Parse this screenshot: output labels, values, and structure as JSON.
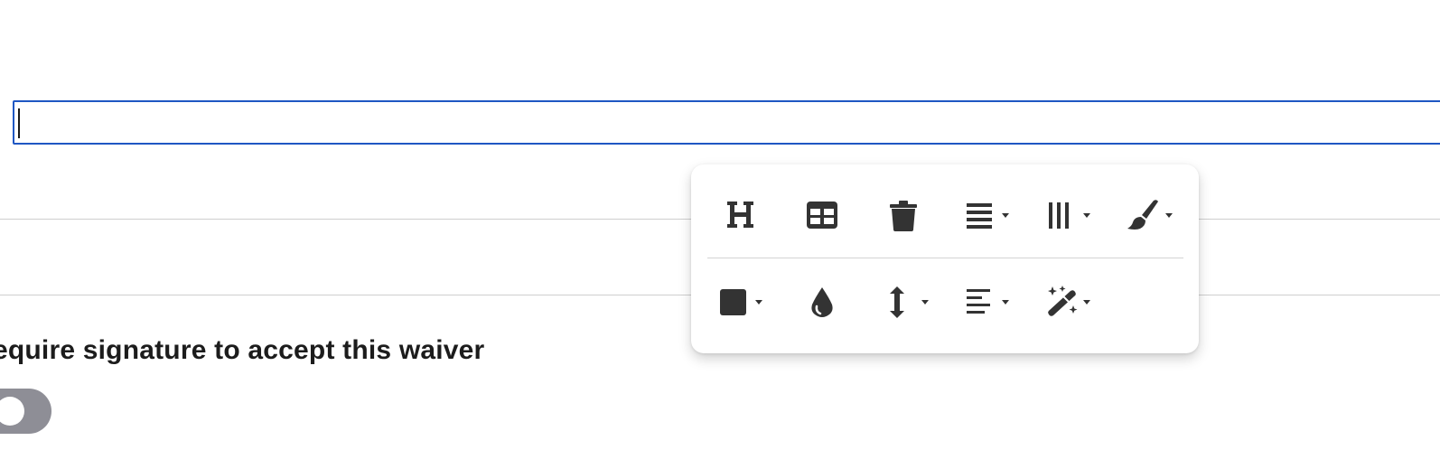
{
  "editor": {
    "value": ""
  },
  "signature": {
    "label": "equire signature to accept this waiver",
    "toggle_on": false
  },
  "toolbar": {
    "row1": [
      {
        "icon": "heading-icon",
        "has_dropdown": false
      },
      {
        "icon": "table-icon",
        "has_dropdown": false
      },
      {
        "icon": "trash-icon",
        "has_dropdown": false
      },
      {
        "icon": "align-justify-icon",
        "has_dropdown": true
      },
      {
        "icon": "columns-icon",
        "has_dropdown": true
      },
      {
        "icon": "paint-brush-icon",
        "has_dropdown": true
      }
    ],
    "row2": [
      {
        "icon": "square-color-icon",
        "has_dropdown": true
      },
      {
        "icon": "droplet-icon",
        "has_dropdown": false
      },
      {
        "icon": "vertical-arrows-icon",
        "has_dropdown": true
      },
      {
        "icon": "align-left-icon",
        "has_dropdown": true
      },
      {
        "icon": "magic-wand-icon",
        "has_dropdown": true
      }
    ]
  },
  "colors": {
    "focus_border": "#1f57c3",
    "icon": "#333333",
    "toggle_off": "#8e8e96"
  }
}
